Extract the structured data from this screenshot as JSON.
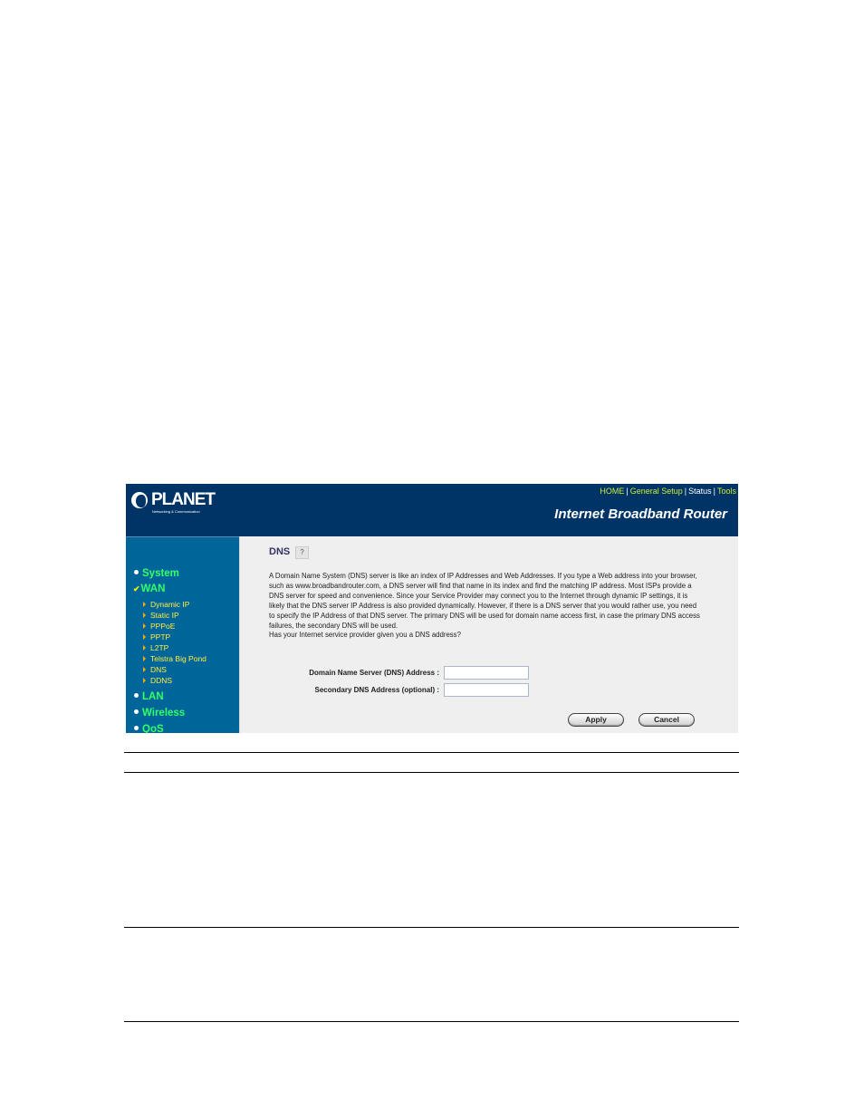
{
  "header": {
    "logo_text": "PLANET",
    "logo_subtitle": "Networking & Communication",
    "product_title": "Internet Broadband Router",
    "top_links": [
      "HOME",
      "General Setup",
      "Status",
      "Tools"
    ]
  },
  "sidebar": {
    "items": [
      {
        "label": "System",
        "marker": "bullet"
      },
      {
        "label": "WAN",
        "marker": "check",
        "expanded": true,
        "children": [
          "Dynamic IP",
          "Static IP",
          "PPPoE",
          "PPTP",
          "L2TP",
          "Telstra Big Pond",
          "DNS",
          "DDNS"
        ]
      },
      {
        "label": "LAN",
        "marker": "bullet"
      },
      {
        "label": "Wireless",
        "marker": "bullet"
      },
      {
        "label": "QoS",
        "marker": "bullet"
      }
    ]
  },
  "main": {
    "title": "DNS",
    "help_icon": "help-icon",
    "description": "A Domain Name System (DNS) server is like an index of IP Addresses and Web Addresses. If you type a Web address into your browser, such as www.broadbandrouter.com, a DNS server will find that name in its index and find the matching IP address. Most ISPs provide a DNS server for speed and convenience. Since your Service Provider may connect you to the Internet through dynamic IP settings, it is likely that the DNS server IP Address is also provided dynamically. However, if there is a DNS server that you would rather use, you need to specify the IP Address of that DNS server. The primary DNS will be used for domain name access first, in case the primary DNS access failures, the secondary DNS will be used.",
    "question": "Has your Internet service provider given you a DNS address?",
    "fields": [
      {
        "label": "Domain Name Server (DNS) Address :",
        "value": ""
      },
      {
        "label": "Secondary DNS Address (optional) :",
        "value": ""
      }
    ],
    "buttons": {
      "apply": "Apply",
      "cancel": "Cancel"
    }
  },
  "colors": {
    "header_bg": "#003366",
    "sidebar_bg": "#006699",
    "nav_main": "#33ff66",
    "nav_sub": "#ffee44",
    "top_link": "#ccee33",
    "content_bg": "#efefef",
    "title": "#333366"
  }
}
